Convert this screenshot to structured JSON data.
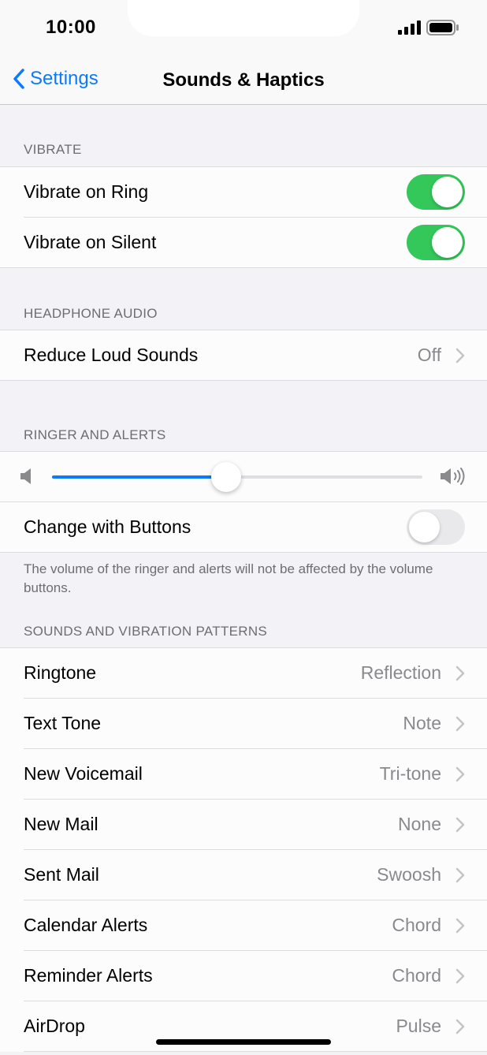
{
  "status": {
    "time": "10:00"
  },
  "nav": {
    "back_label": "Settings",
    "title": "Sounds & Haptics"
  },
  "vibrate": {
    "header": "VIBRATE",
    "items": [
      {
        "label": "Vibrate on Ring",
        "toggle": "on"
      },
      {
        "label": "Vibrate on Silent",
        "toggle": "on"
      }
    ]
  },
  "headphone": {
    "header": "HEADPHONE AUDIO",
    "items": [
      {
        "label": "Reduce Loud Sounds",
        "value": "Off"
      }
    ]
  },
  "ringer": {
    "header": "RINGER AND ALERTS",
    "volume_level": 0.47,
    "change_with_buttons": {
      "label": "Change with Buttons",
      "toggle": "off"
    },
    "footer": "The volume of the ringer and alerts will not be affected by the volume buttons."
  },
  "patterns": {
    "header": "SOUNDS AND VIBRATION PATTERNS",
    "items": [
      {
        "label": "Ringtone",
        "value": "Reflection"
      },
      {
        "label": "Text Tone",
        "value": "Note"
      },
      {
        "label": "New Voicemail",
        "value": "Tri-tone"
      },
      {
        "label": "New Mail",
        "value": "None"
      },
      {
        "label": "Sent Mail",
        "value": "Swoosh"
      },
      {
        "label": "Calendar Alerts",
        "value": "Chord"
      },
      {
        "label": "Reminder Alerts",
        "value": "Chord"
      },
      {
        "label": "AirDrop",
        "value": "Pulse"
      }
    ]
  },
  "colors": {
    "accent": "#0a7aff",
    "toggle_on": "#34c759",
    "background": "#f2f2f7"
  }
}
